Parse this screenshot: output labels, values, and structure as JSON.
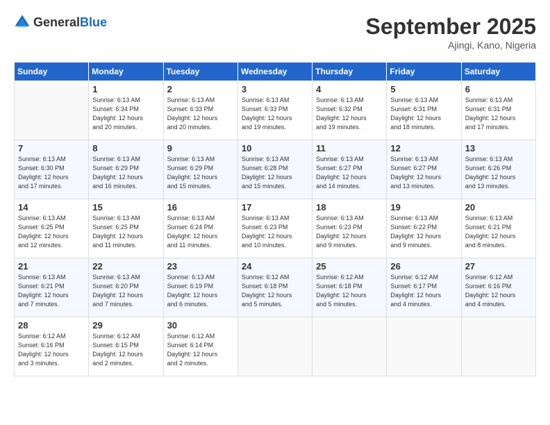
{
  "header": {
    "logo_general": "General",
    "logo_blue": "Blue",
    "title": "September 2025",
    "location": "Ajingi, Kano, Nigeria"
  },
  "columns": [
    "Sunday",
    "Monday",
    "Tuesday",
    "Wednesday",
    "Thursday",
    "Friday",
    "Saturday"
  ],
  "weeks": [
    [
      {
        "day": "",
        "info": ""
      },
      {
        "day": "1",
        "info": "Sunrise: 6:13 AM\nSunset: 6:34 PM\nDaylight: 12 hours\nand 20 minutes."
      },
      {
        "day": "2",
        "info": "Sunrise: 6:13 AM\nSunset: 6:33 PM\nDaylight: 12 hours\nand 20 minutes."
      },
      {
        "day": "3",
        "info": "Sunrise: 6:13 AM\nSunset: 6:33 PM\nDaylight: 12 hours\nand 19 minutes."
      },
      {
        "day": "4",
        "info": "Sunrise: 6:13 AM\nSunset: 6:32 PM\nDaylight: 12 hours\nand 19 minutes."
      },
      {
        "day": "5",
        "info": "Sunrise: 6:13 AM\nSunset: 6:31 PM\nDaylight: 12 hours\nand 18 minutes."
      },
      {
        "day": "6",
        "info": "Sunrise: 6:13 AM\nSunset: 6:31 PM\nDaylight: 12 hours\nand 17 minutes."
      }
    ],
    [
      {
        "day": "7",
        "info": "Sunrise: 6:13 AM\nSunset: 6:30 PM\nDaylight: 12 hours\nand 17 minutes."
      },
      {
        "day": "8",
        "info": "Sunrise: 6:13 AM\nSunset: 6:29 PM\nDaylight: 12 hours\nand 16 minutes."
      },
      {
        "day": "9",
        "info": "Sunrise: 6:13 AM\nSunset: 6:29 PM\nDaylight: 12 hours\nand 15 minutes."
      },
      {
        "day": "10",
        "info": "Sunrise: 6:13 AM\nSunset: 6:28 PM\nDaylight: 12 hours\nand 15 minutes."
      },
      {
        "day": "11",
        "info": "Sunrise: 6:13 AM\nSunset: 6:27 PM\nDaylight: 12 hours\nand 14 minutes."
      },
      {
        "day": "12",
        "info": "Sunrise: 6:13 AM\nSunset: 6:27 PM\nDaylight: 12 hours\nand 13 minutes."
      },
      {
        "day": "13",
        "info": "Sunrise: 6:13 AM\nSunset: 6:26 PM\nDaylight: 12 hours\nand 13 minutes."
      }
    ],
    [
      {
        "day": "14",
        "info": "Sunrise: 6:13 AM\nSunset: 6:25 PM\nDaylight: 12 hours\nand 12 minutes."
      },
      {
        "day": "15",
        "info": "Sunrise: 6:13 AM\nSunset: 6:25 PM\nDaylight: 12 hours\nand 11 minutes."
      },
      {
        "day": "16",
        "info": "Sunrise: 6:13 AM\nSunset: 6:24 PM\nDaylight: 12 hours\nand 11 minutes."
      },
      {
        "day": "17",
        "info": "Sunrise: 6:13 AM\nSunset: 6:23 PM\nDaylight: 12 hours\nand 10 minutes."
      },
      {
        "day": "18",
        "info": "Sunrise: 6:13 AM\nSunset: 6:23 PM\nDaylight: 12 hours\nand 9 minutes."
      },
      {
        "day": "19",
        "info": "Sunrise: 6:13 AM\nSunset: 6:22 PM\nDaylight: 12 hours\nand 9 minutes."
      },
      {
        "day": "20",
        "info": "Sunrise: 6:13 AM\nSunset: 6:21 PM\nDaylight: 12 hours\nand 8 minutes."
      }
    ],
    [
      {
        "day": "21",
        "info": "Sunrise: 6:13 AM\nSunset: 6:21 PM\nDaylight: 12 hours\nand 7 minutes."
      },
      {
        "day": "22",
        "info": "Sunrise: 6:13 AM\nSunset: 6:20 PM\nDaylight: 12 hours\nand 7 minutes."
      },
      {
        "day": "23",
        "info": "Sunrise: 6:13 AM\nSunset: 6:19 PM\nDaylight: 12 hours\nand 6 minutes."
      },
      {
        "day": "24",
        "info": "Sunrise: 6:12 AM\nSunset: 6:18 PM\nDaylight: 12 hours\nand 5 minutes."
      },
      {
        "day": "25",
        "info": "Sunrise: 6:12 AM\nSunset: 6:18 PM\nDaylight: 12 hours\nand 5 minutes."
      },
      {
        "day": "26",
        "info": "Sunrise: 6:12 AM\nSunset: 6:17 PM\nDaylight: 12 hours\nand 4 minutes."
      },
      {
        "day": "27",
        "info": "Sunrise: 6:12 AM\nSunset: 6:16 PM\nDaylight: 12 hours\nand 4 minutes."
      }
    ],
    [
      {
        "day": "28",
        "info": "Sunrise: 6:12 AM\nSunset: 6:16 PM\nDaylight: 12 hours\nand 3 minutes."
      },
      {
        "day": "29",
        "info": "Sunrise: 6:12 AM\nSunset: 6:15 PM\nDaylight: 12 hours\nand 2 minutes."
      },
      {
        "day": "30",
        "info": "Sunrise: 6:12 AM\nSunset: 6:14 PM\nDaylight: 12 hours\nand 2 minutes."
      },
      {
        "day": "",
        "info": ""
      },
      {
        "day": "",
        "info": ""
      },
      {
        "day": "",
        "info": ""
      },
      {
        "day": "",
        "info": ""
      }
    ]
  ]
}
